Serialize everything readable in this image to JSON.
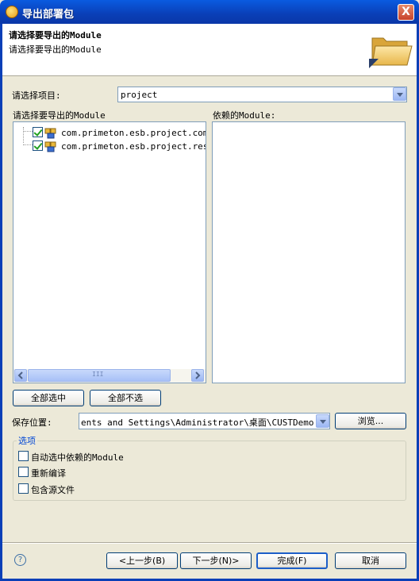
{
  "window": {
    "title": "导出部署包",
    "close_label": "X"
  },
  "banner": {
    "title": "请选择要导出的Module",
    "subtitle": "请选择要导出的Module"
  },
  "project": {
    "label": "请选择项目:",
    "value": "project"
  },
  "modules": {
    "label": "请选择要导出的Module",
    "items": [
      {
        "label": "com.primeton.esb.project.common",
        "checked": true
      },
      {
        "label": "com.primeton.esb.project.restaw",
        "checked": true
      }
    ],
    "scroll_grip": "III"
  },
  "dependencies": {
    "label": "依赖的Module:"
  },
  "buttons": {
    "select_all": "全部选中",
    "deselect_all": "全部不选",
    "browse": "浏览...",
    "prev": "<上一步(B)",
    "next": "下一步(N)>",
    "finish": "完成(F)",
    "cancel": "取消"
  },
  "save": {
    "label": "保存位置:",
    "value": "ents and Settings\\Administrator\\桌面\\CUSTDemo.ecd"
  },
  "options": {
    "title": "选项",
    "items": [
      {
        "label": "自动选中依赖的Module",
        "checked": false
      },
      {
        "label": "重新编译",
        "checked": false
      },
      {
        "label": "包含源文件",
        "checked": false
      }
    ]
  },
  "help_icon": "?",
  "colors": {
    "titlebar": "#0a3fb7",
    "group_title": "#0046d5",
    "dialog_bg": "#ece9d8"
  }
}
